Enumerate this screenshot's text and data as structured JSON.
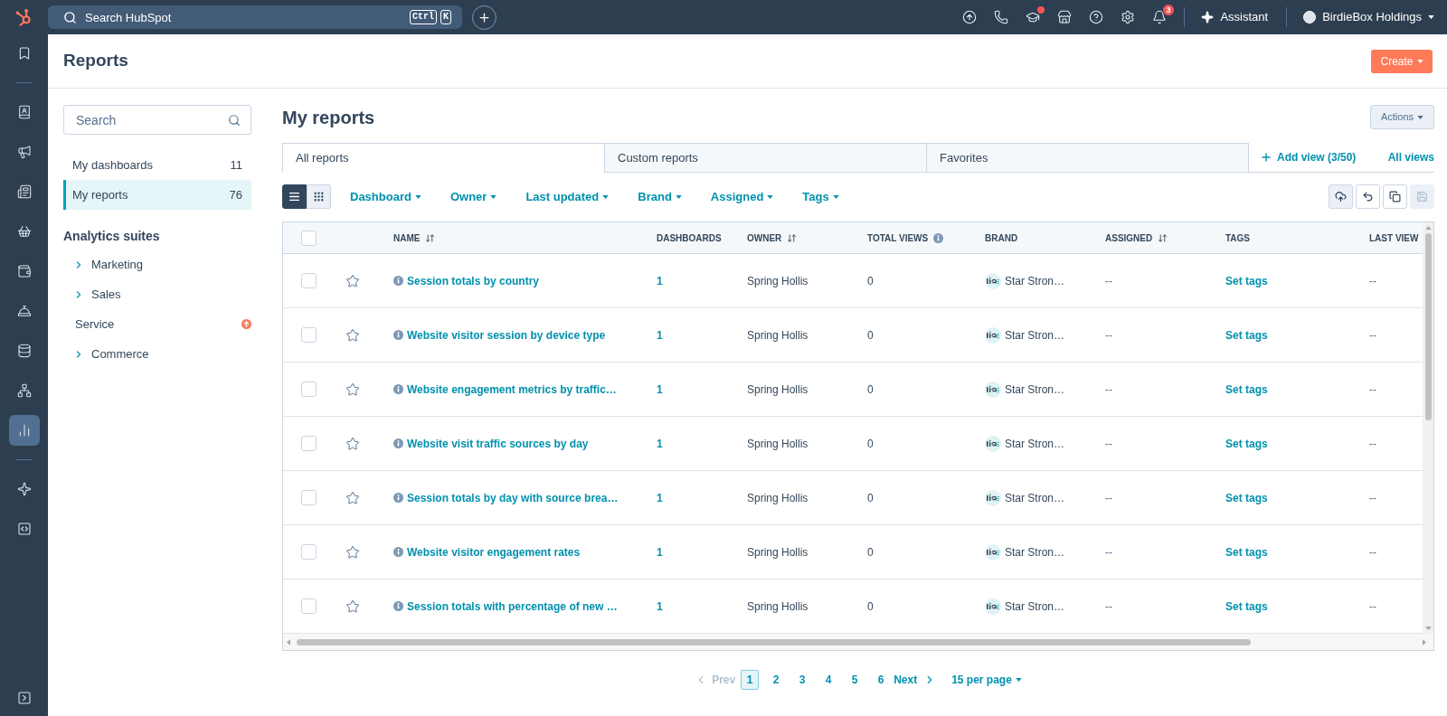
{
  "top_bar": {
    "search": {
      "placeholder": "Search HubSpot",
      "shortcut_keys": [
        "Ctrl",
        "K"
      ]
    },
    "tools": [
      {
        "kind": "upgrade",
        "alert_dot": false
      },
      {
        "kind": "calling",
        "alert_dot": false
      },
      {
        "kind": "academy",
        "alert_dot": true
      },
      {
        "kind": "marketplace",
        "alert_dot": false
      },
      {
        "kind": "help",
        "alert_dot": false
      },
      {
        "kind": "settings",
        "alert_dot": false
      },
      {
        "kind": "notifications",
        "alert_dot": false,
        "badge": "3"
      }
    ],
    "assistant": "Assistant",
    "account": "BirdieBox Holdings"
  },
  "rail": {
    "sections": [
      [
        {
          "kind": "bookmarks",
          "selected": false
        }
      ],
      [
        {
          "kind": "contacts",
          "selected": false
        },
        {
          "kind": "marketing",
          "selected": false
        },
        {
          "kind": "content",
          "selected": false
        },
        {
          "kind": "commerce",
          "selected": false
        },
        {
          "kind": "payments",
          "selected": false
        },
        {
          "kind": "service",
          "selected": false
        },
        {
          "kind": "data",
          "selected": false
        },
        {
          "kind": "automation",
          "selected": false
        },
        {
          "kind": "reporting",
          "selected": true
        }
      ],
      [
        {
          "kind": "assistant",
          "selected": false
        },
        {
          "kind": "development",
          "selected": false
        }
      ]
    ]
  },
  "header": {
    "title": "Reports",
    "create_button": "Create"
  },
  "sidebar": {
    "search": {
      "placeholder": "Search"
    },
    "items": [
      {
        "label": "My dashboards",
        "count": "11",
        "selected": false
      },
      {
        "label": "My reports",
        "count": "76",
        "selected": true
      }
    ],
    "section_title": "Analytics suites",
    "suites": [
      {
        "label": "Marketing",
        "kind": "expandable"
      },
      {
        "label": "Sales",
        "kind": "expandable"
      },
      {
        "label": "Service",
        "kind": "upgrade"
      },
      {
        "label": "Commerce",
        "kind": "expandable"
      }
    ]
  },
  "content": {
    "title": "My reports",
    "actions_button": "Actions",
    "tabs": [
      {
        "label": "All reports",
        "selected": true
      },
      {
        "label": "Custom reports",
        "selected": false
      },
      {
        "label": "Favorites",
        "selected": false
      }
    ],
    "add_view": "Add view (3/50)",
    "all_views": "All views",
    "view_modes": [
      {
        "kind": "list",
        "selected": true
      },
      {
        "kind": "grid",
        "selected": false
      }
    ],
    "filters": [
      "Dashboard",
      "Owner",
      "Last updated",
      "Brand",
      "Assigned",
      "Tags"
    ],
    "tools": [
      {
        "kind": "cloud",
        "disabled": false
      },
      {
        "kind": "undo",
        "disabled": false
      },
      {
        "kind": "copy",
        "disabled": false
      },
      {
        "kind": "save",
        "disabled": true
      }
    ]
  },
  "table": {
    "select_all_checked": false,
    "columns": [
      {
        "label": "NAME",
        "kind": "sortable"
      },
      {
        "label": "DASHBOARDS",
        "kind": "plain"
      },
      {
        "label": "OWNER",
        "kind": "sortable"
      },
      {
        "label": "TOTAL VIEWS",
        "kind": "info"
      },
      {
        "label": "BRAND",
        "kind": "plain"
      },
      {
        "label": "ASSIGNED",
        "kind": "sortable"
      },
      {
        "label": "TAGS",
        "kind": "plain"
      },
      {
        "label": "LAST VIEW",
        "kind": "plain"
      }
    ],
    "rows": [
      {
        "checked": false,
        "favorite": false,
        "name": "Session totals by country",
        "dashboards": "1",
        "owner": "Spring Hollis",
        "total_views": "0",
        "brand": "Star Stron…",
        "assigned": "--",
        "tags": "Set tags",
        "last_viewed": "--"
      },
      {
        "checked": false,
        "favorite": false,
        "name": "Website visitor session by device type",
        "dashboards": "1",
        "owner": "Spring Hollis",
        "total_views": "0",
        "brand": "Star Stron…",
        "assigned": "--",
        "tags": "Set tags",
        "last_viewed": "--"
      },
      {
        "checked": false,
        "favorite": false,
        "name": "Website engagement metrics by traffic…",
        "dashboards": "1",
        "owner": "Spring Hollis",
        "total_views": "0",
        "brand": "Star Stron…",
        "assigned": "--",
        "tags": "Set tags",
        "last_viewed": "--"
      },
      {
        "checked": false,
        "favorite": false,
        "name": "Website visit traffic sources by day",
        "dashboards": "1",
        "owner": "Spring Hollis",
        "total_views": "0",
        "brand": "Star Stron…",
        "assigned": "--",
        "tags": "Set tags",
        "last_viewed": "--"
      },
      {
        "checked": false,
        "favorite": false,
        "name": "Session totals by day with source brea…",
        "dashboards": "1",
        "owner": "Spring Hollis",
        "total_views": "0",
        "brand": "Star Stron…",
        "assigned": "--",
        "tags": "Set tags",
        "last_viewed": "--"
      },
      {
        "checked": false,
        "favorite": false,
        "name": "Website visitor engagement rates",
        "dashboards": "1",
        "owner": "Spring Hollis",
        "total_views": "0",
        "brand": "Star Stron…",
        "assigned": "--",
        "tags": "Set tags",
        "last_viewed": "--"
      },
      {
        "checked": false,
        "favorite": false,
        "name": "Session totals with percentage of new …",
        "dashboards": "1",
        "owner": "Spring Hollis",
        "total_views": "0",
        "brand": "Star Stron…",
        "assigned": "--",
        "tags": "Set tags",
        "last_viewed": "--"
      }
    ]
  },
  "pagination": {
    "prev": "Prev",
    "prev_disabled": true,
    "pages": [
      {
        "label": "1",
        "selected": true
      },
      {
        "label": "2",
        "selected": false
      },
      {
        "label": "3",
        "selected": false
      },
      {
        "label": "4",
        "selected": false
      },
      {
        "label": "5",
        "selected": false
      },
      {
        "label": "6",
        "selected": false
      }
    ],
    "next": "Next",
    "per_page": "15 per page"
  }
}
